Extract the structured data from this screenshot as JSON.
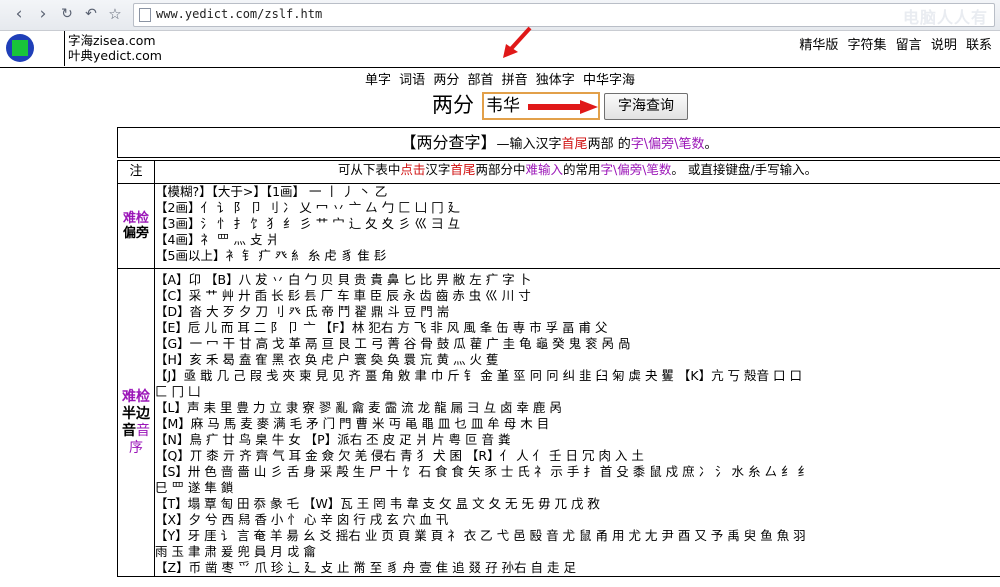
{
  "browser": {
    "url": "www.yedict.com/zslf.htm",
    "watermark": "电脑人人有"
  },
  "header": {
    "site1": "字海zisea.com",
    "site2": "叶典yedict.com",
    "menu": [
      "精华版",
      "字符集",
      "留言",
      "说明",
      "联系"
    ]
  },
  "subnav": [
    "单字",
    "词语",
    "两分",
    "部首",
    "拼音",
    "独体字",
    "中华字海"
  ],
  "search": {
    "label": "两分",
    "value": "韦华",
    "button": "字海查询"
  },
  "title": {
    "main": "【两分查字】",
    "desc_1": "—输入汉字",
    "desc_2": "首尾",
    "desc_3": "两部 的",
    "desc_4": "字\\偏旁\\笔数",
    "desc_5": "。"
  },
  "note": {
    "label": "注",
    "t1": "可从下表中",
    "t2": "点击",
    "t3": "汉字",
    "t4": "首尾",
    "t5": "两部分中",
    "t6": "难输入",
    "t7": "的常用",
    "t8": "字\\偏旁\\笔数",
    "t9": "。 或直接键盘/手写输入。"
  },
  "radical_section": {
    "label1": "难检",
    "label2": "偏旁",
    "lines": [
      "【模糊?】【大于>】【1画】 一 丨 丿 丶 乙",
      "【2画】亻 讠 阝 卩 刂 冫     乂 冖 丷 亠       厶 勹 匚 凵 冂 廴",
      "【3画】氵 忄 扌 饣 犭 纟 彡 艹 宀 辶 夂 夊 彡 巛 彐 彑",
      "【4画】礻 罒 灬              攴 爿",
      "【5画以上】衤 钅 疒            癶 糹 糸 虍     豸 隹       髟"
    ]
  },
  "half_section": {
    "label1": "难检",
    "label2": "半边",
    "label3": "音",
    "label4": "音",
    "label5": "序",
    "lines": [
      "【A】卬 【B】八 犮 丷 白 勹 贝 貝 贵 貴 鼻 匕 比 畀 敝 左 疒 字 卜",
      "【C】采 艹 艸 廾 臿 长 髟 镸 厂 车 車 臣 辰 永 齿 齒 赤 虫 巛 川 寸",
      "【D】沓 大 歹 夕 刀 刂 癶 氐 帝 鬥 翟 鼎 斗 豆 門 耑",
      "【E】卮 儿 而 耳 二 阝 卩 亠 【F】林 犯右 方 飞 非 风 風 夆 缶 専 市 孚 畐 甫 父",
      "【G】一 冖 干 甘 高 戈 革 鬲 亘 艮 工 弓 菁 谷 骨 鼓 瓜 雚 广 圭 龟 龜 癸 鬼 衮 呙 咼",
      "【H】亥 禾 曷 盍 隺 黑 衣 奂 虍 户 寰 奐 奂 睘 巟 黄 灬 火 蒦",
      "【J】亟 戢 几 己 叚 戋 夾 柬 見 见 齐 畺 角 敫 聿 巾 斤 钅 金 堇 巠 冋 冋 纠 韭 臼 匊 虡 夬 矍 【K】亢 丂 殻音 口 口",
      "匚 冂 凵",
      "【L】声 耒 里 豊 力 立 隶 寮 翏 亂 龠 麦 霝 流 龙 龍 屚 彐 彑 卤 幸 鹿 呙",
      "【M】麻 马 馬 麦 麥 满 毛 矛 门 門 曹 米 丏 黾 黽 皿 乜 皿 牟 母 木 目",
      "【N】鳥 疒 廿 鸟 臬 牛 女 【P】派右 丕 皮 疋 爿 片 粤 叵 音 粪",
      "【Q】丌 桼 亓 齐 齊 气 耳 金 僉 欠 羌 侵右 青 犭 犬 囷 【R】亻 人 亻 壬 日 冗 肉 入 土",
      "【S】卅 色 啬 嗇 山 彡 舌 身 采 殸 生 尸 十 饣 石 食 食 矢 豕 士 氏 礻 示 手 扌 首 殳 黍 鼠 戍 庶 冫 氵 水 糸 厶 纟 纟",
      "巳 罒 遂 隼 鎖",
      "【T】塌 覃 匋 田 忝 彖 乇 【W】瓦 王 罔 韦 韋 支 攵 昷 文 夂 无 旡 毋 兀 戊 敄",
      "【X】夕 兮 西 舄 香 小 忄 心 辛 囟 行 戌 玄 穴 血 卂",
      "【Y】牙 厓 讠 言 奄 羊 昜 幺 爻 摇右 业 页 頁 業 頁 礻 衣 乙 弋 邑 殹 音 尤 鼠 甬 用 尤 尢 尹 酉 又 予 禹 臾 鱼 魚 羽",
      "雨 玉 聿 肃 爰 兜 員 月 戉 龠",
      "【Z】币 凿 枣 爫 爪 珍 辶 廴 攴 止 黹 至 豸 舟 壹     隹 追 叕 孖 孙右 自 走 足"
    ]
  }
}
